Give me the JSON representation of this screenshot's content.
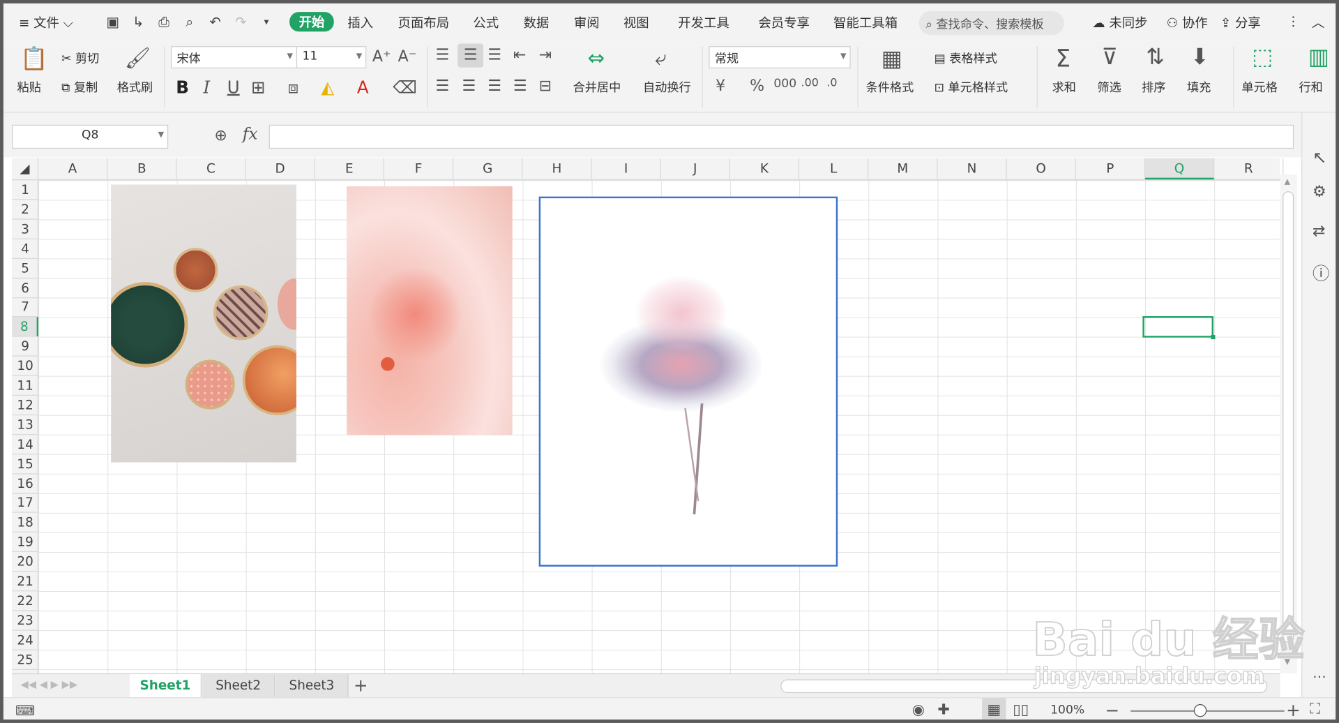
{
  "menubar": {
    "menu_label": "文件",
    "tabs": [
      "开始",
      "插入",
      "页面布局",
      "公式",
      "数据",
      "审阅",
      "视图",
      "开发工具",
      "会员专享",
      "智能工具箱"
    ],
    "search_placeholder": "查找命令、搜索模板",
    "sync": "未同步",
    "collab": "协作",
    "share": "分享"
  },
  "ribbon": {
    "paste": "粘贴",
    "cut": "剪切",
    "copy": "复制",
    "format_painter": "格式刷",
    "font_name": "宋体",
    "font_size": "11",
    "merge_center": "合并居中",
    "wrap_text": "自动换行",
    "number_format": "常规",
    "conditional_format": "条件格式",
    "table_style": "表格样式",
    "cell_style": "单元格样式",
    "sum": "求和",
    "filter": "筛选",
    "sort": "排序",
    "fill": "填充",
    "cell": "单元格",
    "row_col": "行和"
  },
  "formula_bar": {
    "name_box": "Q8",
    "fx": "fx",
    "value": ""
  },
  "sheet": {
    "columns": [
      "A",
      "B",
      "C",
      "D",
      "E",
      "F",
      "G",
      "H",
      "I",
      "J",
      "K",
      "L",
      "M",
      "N",
      "O",
      "P",
      "Q",
      "R"
    ],
    "rows": [
      "1",
      "2",
      "3",
      "4",
      "5",
      "6",
      "7",
      "8",
      "9",
      "10",
      "11",
      "12",
      "13",
      "14",
      "15",
      "16",
      "17",
      "18",
      "19",
      "20",
      "21",
      "22",
      "23",
      "24",
      "25"
    ],
    "selected_cell": "Q8",
    "tabs": [
      "Sheet1",
      "Sheet2",
      "Sheet3"
    ],
    "add_tab": "+"
  },
  "status": {
    "zoom": "100%"
  },
  "watermark": {
    "brand": "Bai du 经验",
    "url": "jingyan.baidu.com"
  }
}
